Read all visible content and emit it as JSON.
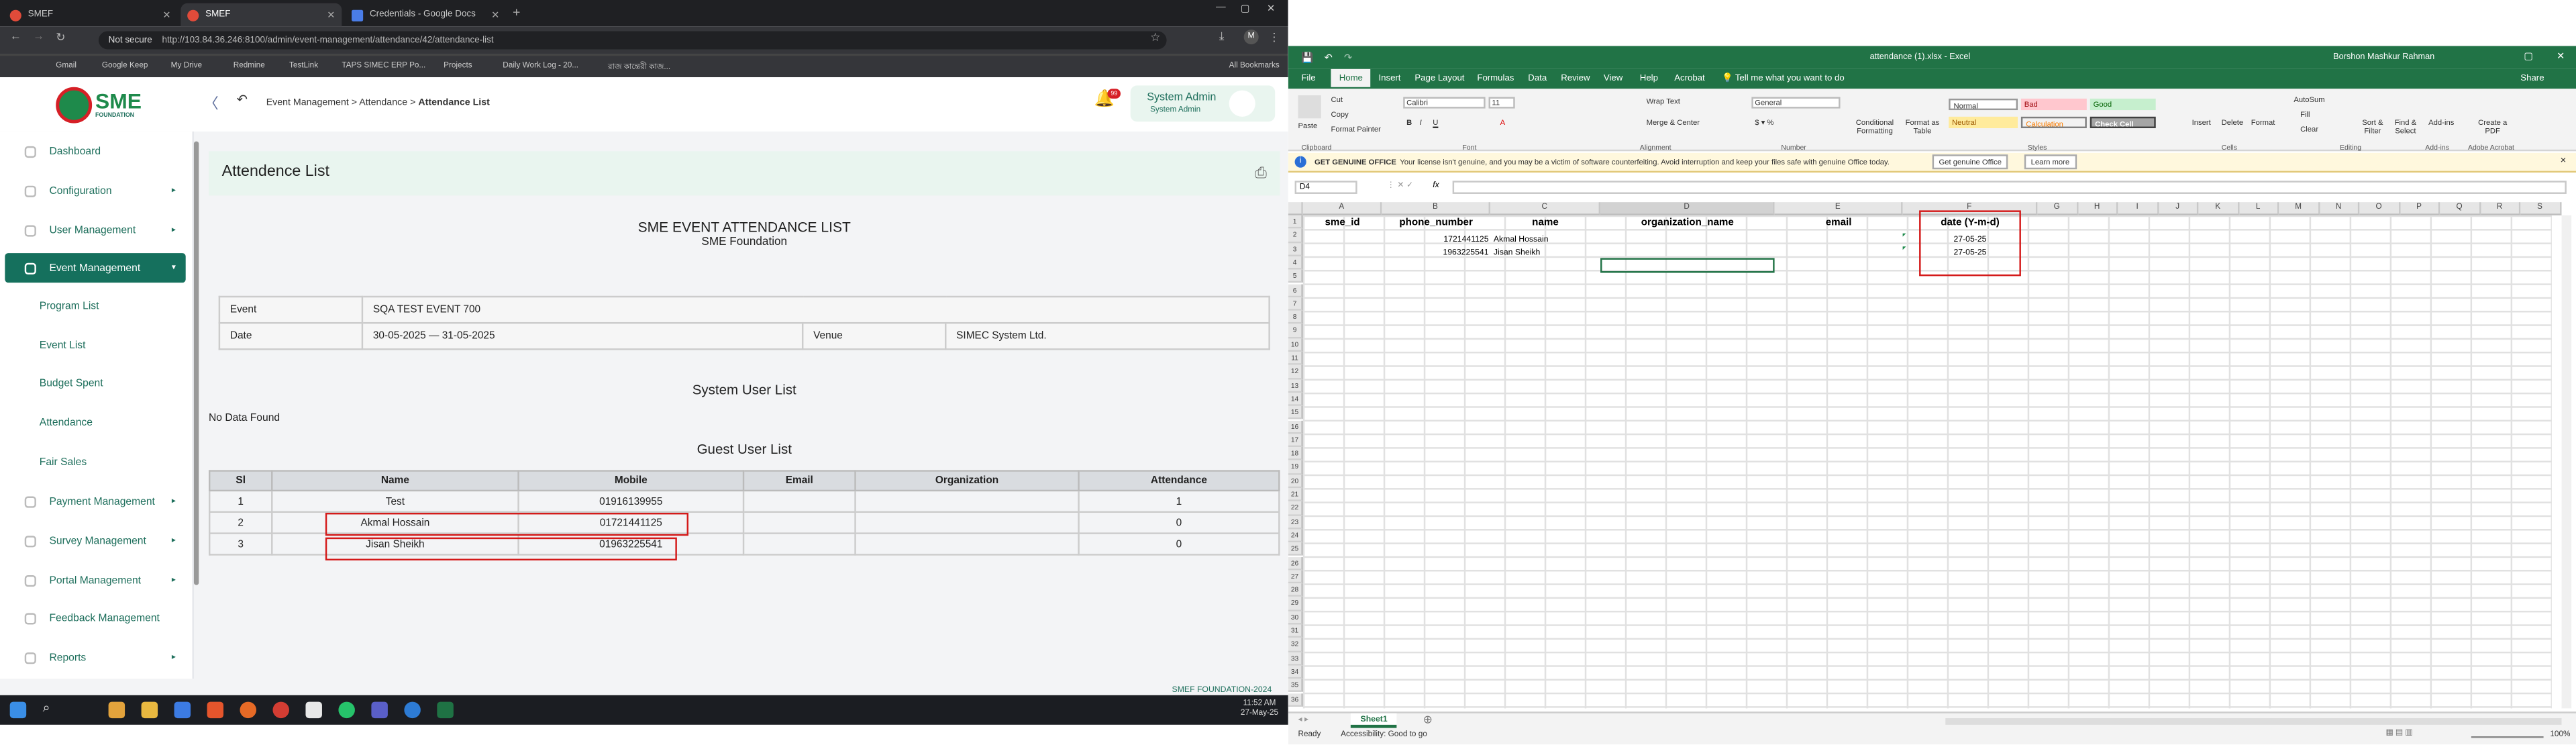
{
  "browser": {
    "tabs": [
      {
        "label": "SMEF"
      },
      {
        "label": "SMEF"
      },
      {
        "label": "Credentials - Google Docs"
      }
    ],
    "url_prefix": "Not secure",
    "url": "http://103.84.36.246:8100/admin/event-management/attendance/42/attendance-list",
    "bookmarks": [
      "Gmail",
      "Google Keep",
      "My Drive",
      "Redmine",
      "TestLink",
      "TAPS SIMEC ERP Po...",
      "Projects",
      "Daily Work Log - 20...",
      "রাজ কান্তেরী কাজ...",
      "All Bookmarks"
    ]
  },
  "app": {
    "logo_text": "SME",
    "logo_sub": "FOUNDATION",
    "breadcrumb": [
      "Event Management",
      "Attendance",
      "Attendance List"
    ],
    "breadcrumb_sep": ">",
    "notif_count": "99",
    "user_name": "System Admin",
    "user_role": "System Admin",
    "sidebar": {
      "items": [
        {
          "label": "Dashboard"
        },
        {
          "label": "Configuration"
        },
        {
          "label": "User Management"
        },
        {
          "label": "Event Management"
        },
        {
          "label": "Payment Management"
        },
        {
          "label": "Survey Management"
        },
        {
          "label": "Portal Management"
        },
        {
          "label": "Feedback Management"
        },
        {
          "label": "Reports"
        }
      ],
      "sub_items": [
        {
          "label": "Program List"
        },
        {
          "label": "Event List"
        },
        {
          "label": "Budget Spent"
        },
        {
          "label": "Attendance"
        },
        {
          "label": "Fair Sales"
        }
      ]
    },
    "page_title": "Attendence List",
    "report_title": "SME EVENT ATTENDANCE LIST",
    "report_sub": "SME Foundation",
    "event_label": "Event",
    "event_value": "SQA TEST EVENT 700",
    "date_label": "Date",
    "date_value": "30-05-2025 — 31-05-2025",
    "venue_label": "Venue",
    "venue_value": "SIMEC System Ltd.",
    "system_user_title": "System User List",
    "no_data": "No Data Found",
    "guest_title": "Guest User List",
    "guest_headers": [
      "Sl",
      "Name",
      "Mobile",
      "Email",
      "Organization",
      "Attendance"
    ],
    "guest_rows": [
      {
        "sl": "1",
        "name": "Test",
        "mobile": "01916139955",
        "email": "",
        "org": "",
        "att": "1"
      },
      {
        "sl": "2",
        "name": "Akmal Hossain",
        "mobile": "01721441125",
        "email": "",
        "org": "",
        "att": "0"
      },
      {
        "sl": "3",
        "name": "Jisan Sheikh",
        "mobile": "01963225541",
        "email": "",
        "org": "",
        "att": "0"
      }
    ],
    "footer": "SMEF FOUNDATION-2024"
  },
  "taskbar": {
    "time": "11:52 AM",
    "date": "27-May-25"
  },
  "excel": {
    "title": "attendance (1).xlsx - Excel",
    "user": "Borshon Mashkur Rahman",
    "menu": [
      "File",
      "Home",
      "Insert",
      "Page Layout",
      "Formulas",
      "Data",
      "Review",
      "View",
      "Help",
      "Acrobat",
      "Tell me what you want to do"
    ],
    "share": "Share",
    "ribbon": {
      "paste": "Paste",
      "cut": "Cut",
      "copy": "Copy",
      "format_painter": "Format Painter",
      "font": "Calibri",
      "size": "11",
      "wrap": "Wrap Text",
      "merge": "Merge & Center",
      "number_format": "General",
      "cond": "Conditional Formatting",
      "format_table": "Format as Table",
      "styles": [
        {
          "label": "Normal"
        },
        {
          "label": "Bad"
        },
        {
          "label": "Good"
        },
        {
          "label": "Neutral"
        },
        {
          "label": "Calculation"
        },
        {
          "label": "Check Cell"
        }
      ],
      "insert": "Insert",
      "delete": "Delete",
      "format": "Format",
      "autosum": "AutoSum",
      "fill": "Fill",
      "clear": "Clear",
      "sort": "Sort & Filter",
      "find": "Find & Select",
      "addins": "Add-ins",
      "create_pdf": "Create a PDF",
      "groups": [
        "Clipboard",
        "Font",
        "Alignment",
        "Number",
        "Styles",
        "Cells",
        "Editing",
        "Add-ins",
        "Adobe Acrobat"
      ]
    },
    "infobar": {
      "label": "GET GENUINE OFFICE",
      "text": "Your license isn't genuine, and you may be a victim of software counterfeiting. Avoid interruption and keep your files safe with genuine Office today.",
      "btn1": "Get genuine Office",
      "btn2": "Learn more"
    },
    "namebox": "D4",
    "columns": [
      "A",
      "B",
      "C",
      "D",
      "E",
      "F",
      "G",
      "H",
      "I",
      "J",
      "K",
      "L",
      "M",
      "N",
      "O",
      "P",
      "Q",
      "R",
      "S"
    ],
    "headers": [
      "sme_id",
      "phone_number",
      "name",
      "organization_name",
      "email",
      "date (Y-m-d)"
    ],
    "rows": [
      {
        "phone": "1721441125",
        "name": "Akmal Hossain",
        "date": "27-05-25"
      },
      {
        "phone": "1963225541",
        "name": "Jisan Sheikh",
        "date": "27-05-25"
      }
    ],
    "sheet": "Sheet1",
    "status_ready": "Ready",
    "status_access": "Accessibility: Good to go",
    "zoom": "100%"
  }
}
